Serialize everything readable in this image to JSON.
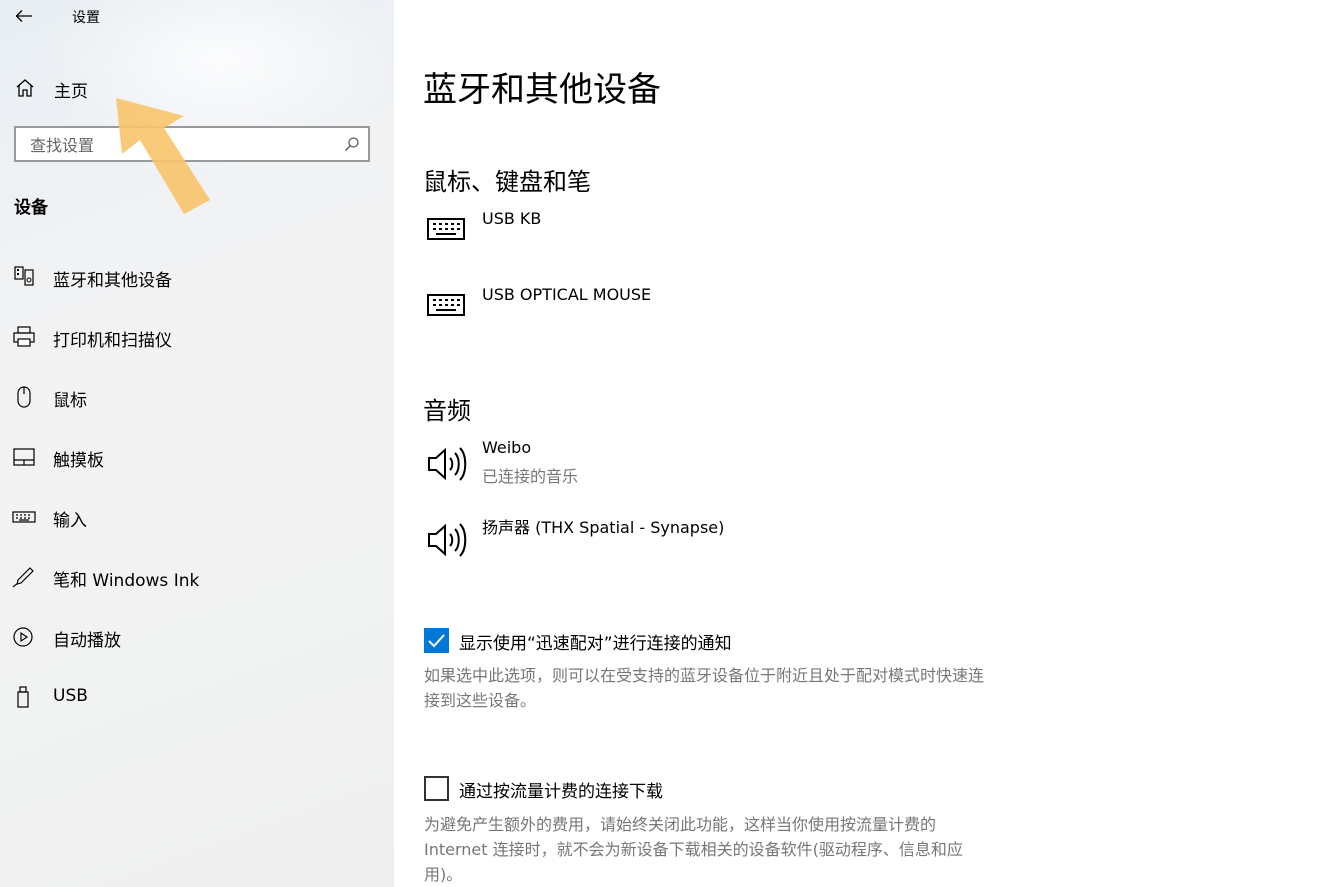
{
  "window": {
    "app_title": "设置",
    "controls": [
      "minimize-icon",
      "maximize-icon",
      "close-icon"
    ]
  },
  "sidebar": {
    "back_icon": "back-arrow-icon",
    "home": {
      "label": "主页",
      "icon": "home-icon"
    },
    "search": {
      "placeholder": "查找设置",
      "value": "",
      "icon": "search-icon"
    },
    "section_label": "设备",
    "items": [
      {
        "label": "蓝牙和其他设备",
        "icon": "bluetooth-devices-icon"
      },
      {
        "label": "打印机和扫描仪",
        "icon": "printer-icon"
      },
      {
        "label": "鼠标",
        "icon": "mouse-icon"
      },
      {
        "label": "触摸板",
        "icon": "touchpad-icon"
      },
      {
        "label": "输入",
        "icon": "keyboard-icon"
      },
      {
        "label": "笔和 Windows Ink",
        "icon": "pen-icon"
      },
      {
        "label": "自动播放",
        "icon": "autoplay-icon"
      },
      {
        "label": "USB",
        "icon": "usb-icon"
      }
    ],
    "annotation_color": "#f7c46c"
  },
  "main": {
    "title": "蓝牙和其他设备",
    "groups": [
      {
        "title": "鼠标、键盘和笔",
        "devices": [
          {
            "name": "USB KB",
            "status": "",
            "icon": "keyboard-icon"
          },
          {
            "name": "USB OPTICAL MOUSE",
            "status": "",
            "icon": "keyboard-icon"
          }
        ]
      },
      {
        "title": "音频",
        "devices": [
          {
            "name": "Weibo",
            "status": "已连接的音乐",
            "icon": "speaker-icon"
          },
          {
            "name": "扬声器 (THX Spatial - Synapse)",
            "status": "",
            "icon": "speaker-icon"
          }
        ]
      }
    ],
    "options": [
      {
        "label": "显示使用“迅速配对”进行连接的通知",
        "checked": true,
        "description": "如果选中此选项，则可以在受支持的蓝牙设备位于附近且处于配对模式时快速连接到这些设备。"
      },
      {
        "label": "通过按流量计费的连接下载",
        "checked": false,
        "description": "为避免产生额外的费用，请始终关闭此功能，这样当你使用按流量计费的 Internet 连接时，就不会为新设备下载相关的设备软件(驱动程序、信息和应用)。"
      }
    ],
    "accent_color": "#0078d7"
  }
}
